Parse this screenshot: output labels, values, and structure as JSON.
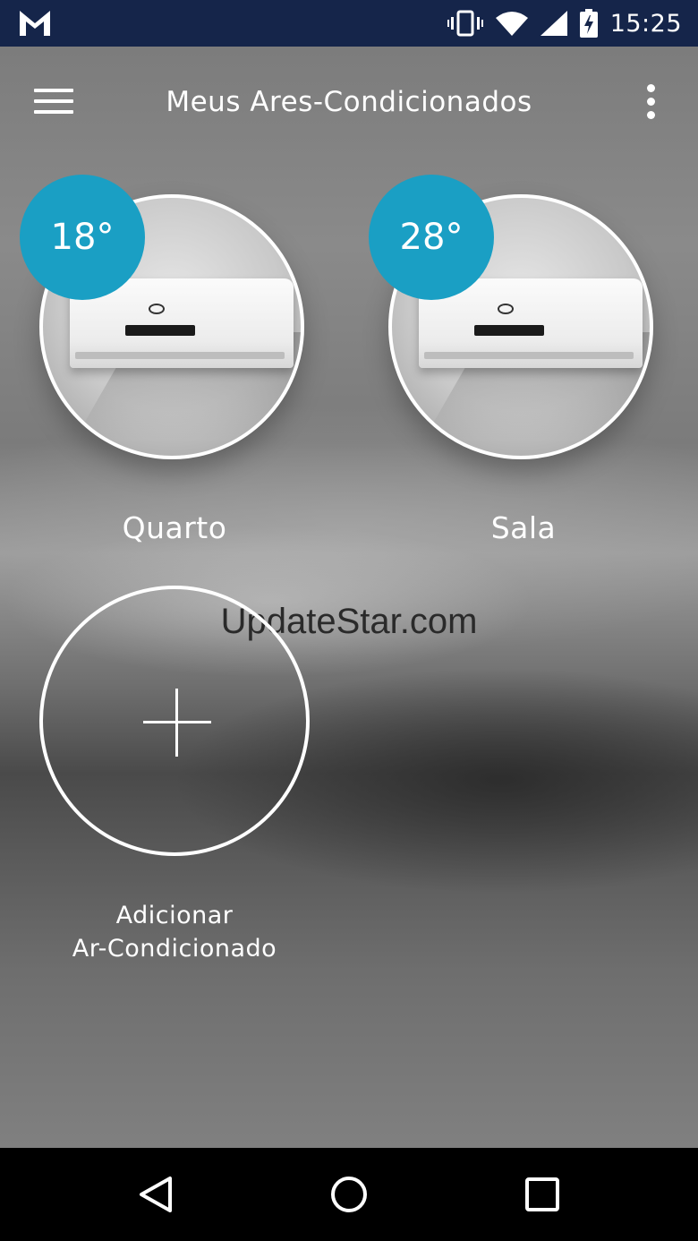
{
  "status_bar": {
    "time": "15:25",
    "icons": [
      "gmail-icon",
      "vibrate-icon",
      "wifi-icon",
      "signal-icon",
      "battery-charging-icon"
    ]
  },
  "app_bar": {
    "title": "Meus Ares-Condicionados",
    "icons": [
      "menu-icon",
      "more-vert-icon"
    ]
  },
  "devices": [
    {
      "name": "Quarto",
      "temperature": "18°"
    },
    {
      "name": "Sala",
      "temperature": "28°"
    }
  ],
  "add_device": {
    "label_line1": "Adicionar",
    "label_line2": "Ar-Condicionado",
    "icon": "plus-icon"
  },
  "watermark": "UpdateStar.com",
  "nav_bar": {
    "icons": [
      "back-icon",
      "home-icon",
      "recents-icon"
    ]
  },
  "colors": {
    "status_bar": "#15254a",
    "accent": "#1a9fc4",
    "nav_bar": "#000000"
  }
}
